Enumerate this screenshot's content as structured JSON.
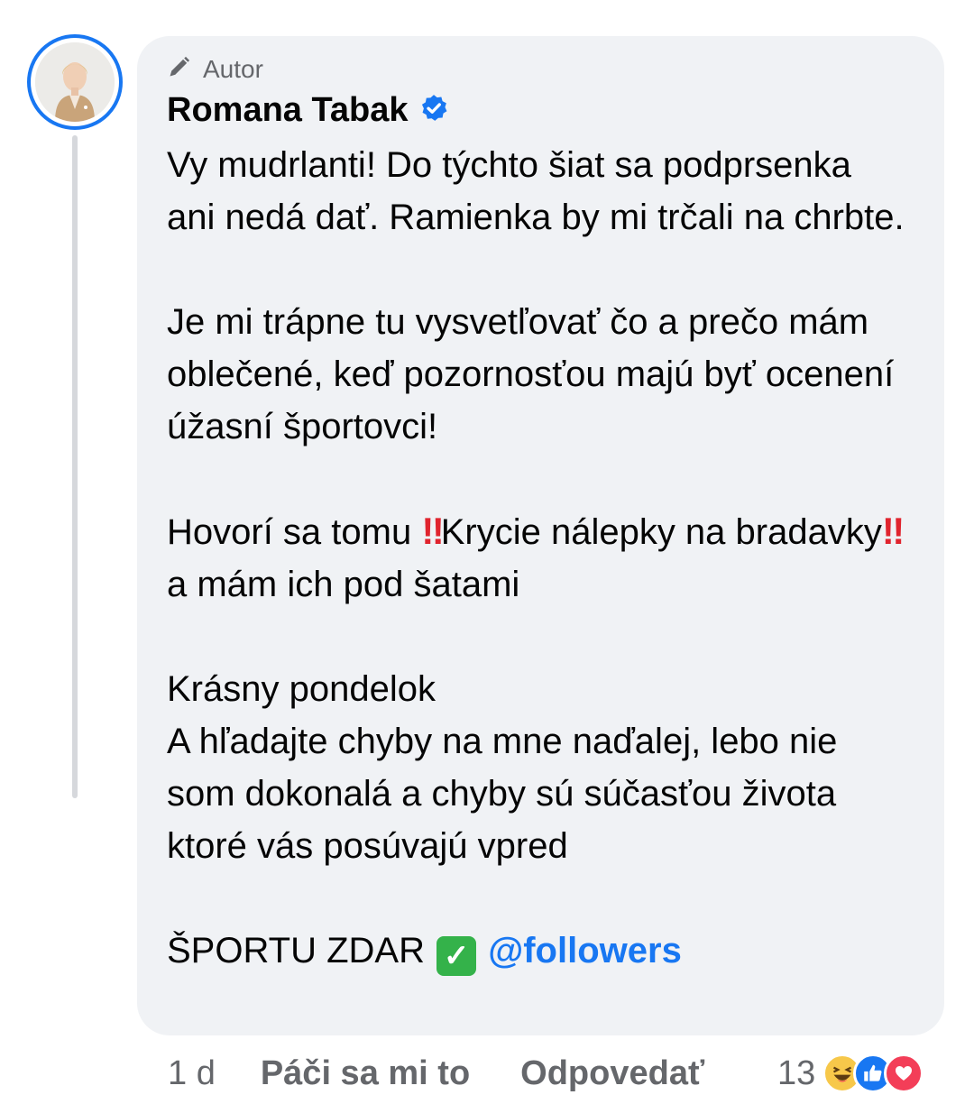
{
  "comment": {
    "author_badge": "Autor",
    "author_name": "Romana Tabak",
    "paragraphs": {
      "p1": "Vy mudrlanti! Do týchto šiat sa podprsenka ani nedá dať. Ramienka by mi trčali na chrbte.",
      "p2": "Je mi trápne tu vysvetľovať čo a prečo mám oblečené, keď pozornosťou majú byť ocenení úžasní športovci!",
      "p3a": "Hovorí sa tomu ",
      "bang": "‼",
      "p3b": "Krycie nálepky na bradavky",
      "p3c": " a mám ich pod šatami",
      "p4a": "Krásny pondelok",
      "p4b": "A hľadajte chyby na mne naďalej, lebo nie som dokonalá a chyby sú súčasťou života ktoré vás posúvajú vpred",
      "p5": "ŠPORTU ZDAR",
      "check": "✓",
      "mention": "@followers"
    }
  },
  "footer": {
    "time": "1 d",
    "like_label": "Páči sa mi to",
    "reply_label": "Odpovedať",
    "reaction_count": "13"
  },
  "reactions": [
    "haha-icon",
    "like-icon",
    "love-icon"
  ],
  "colors": {
    "accent": "#1877f2",
    "bubble": "#f0f2f5",
    "secondary_text": "#65676b",
    "love": "#f33e58",
    "haha": "#f7c84a",
    "check": "#34b24a"
  }
}
